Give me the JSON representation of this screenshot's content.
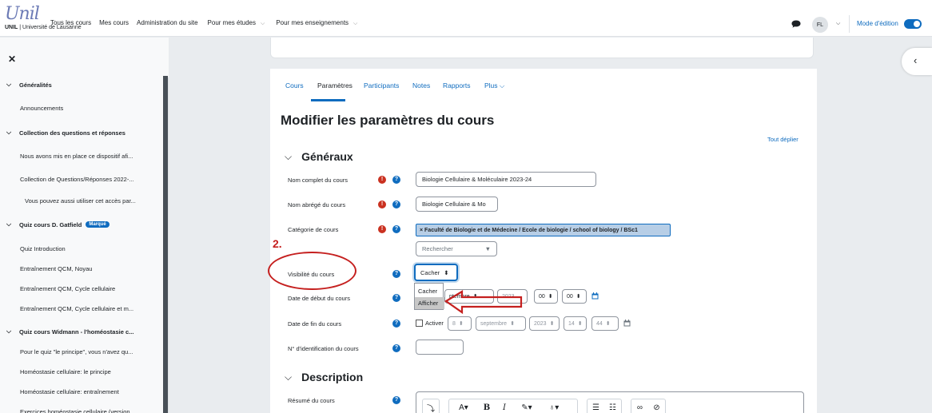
{
  "branding": {
    "logo_script": "Unil",
    "logo_sub_bold": "UNIL",
    "logo_sub_rest": " | Université de Lausanne"
  },
  "primary_nav": {
    "items": [
      "Tous les cours",
      "Mes cours",
      "Administration du site",
      "Pour mes études",
      "Pour mes enseignements"
    ]
  },
  "user": {
    "initials": "FL",
    "edit_mode_label": "Mode d'édition"
  },
  "course_index": {
    "rows": [
      {
        "type": "section",
        "label": "Généralités"
      },
      {
        "type": "item",
        "label": "Announcements"
      },
      {
        "type": "section",
        "label": "Collection des questions et réponses"
      },
      {
        "type": "item",
        "label": "Nous avons mis en place ce dispositif afi..."
      },
      {
        "type": "item",
        "label": "Collection de Questions/Réponses 2022-..."
      },
      {
        "type": "item-indent",
        "label": "Vous pouvez aussi utiliser cet accès par..."
      },
      {
        "type": "section",
        "label": "Quiz cours D. Gatfield",
        "badge": "Marqué"
      },
      {
        "type": "item",
        "label": "Quiz Introduction"
      },
      {
        "type": "item",
        "label": "Entraînement QCM, Noyau"
      },
      {
        "type": "item",
        "label": "Entraînement QCM, Cycle cellulaire"
      },
      {
        "type": "item",
        "label": "Entraînement QCM, Cycle cellulaire et m..."
      },
      {
        "type": "section",
        "label": "Quiz cours Widmann - l'homéostasie c..."
      },
      {
        "type": "item",
        "label": "Pour le quiz \"le principe\", vous n'avez qu..."
      },
      {
        "type": "item",
        "label": "Homéostasie cellulaire: le principe"
      },
      {
        "type": "item",
        "label": "Homéostasie cellulaire: entraînement"
      },
      {
        "type": "item",
        "label": "Exercices homéostasie cellulaire (version..."
      }
    ]
  },
  "secondary_nav": {
    "tabs": [
      "Cours",
      "Paramètres",
      "Participants",
      "Notes",
      "Rapports",
      "Plus"
    ],
    "active": "Paramètres"
  },
  "page": {
    "heading": "Modifier les paramètres du cours",
    "expand_all": "Tout déplier"
  },
  "sections": {
    "general": "Généraux",
    "description": "Description"
  },
  "form": {
    "fullname_label": "Nom complet du cours",
    "fullname_value": "Biologie Cellulaire & Moléculaire 2023-24",
    "shortname_label": "Nom abrégé du cours",
    "shortname_value": "Biologie Cellulaire & Mo",
    "category_label": "Catégorie de cours",
    "category_value": "× Faculté de Biologie et de Médecine / Ecole de biologie / school of biology / BSc1",
    "category_search": "Rechercher",
    "visibility_label": "Visibilité du cours",
    "visibility_value": "Cacher",
    "visibility_options": [
      "Cacher",
      "Afficher"
    ],
    "start_label": "Date de début du cours",
    "start_month_partial": "ptembre",
    "start_year": "2023",
    "start_hour": "00",
    "start_minute": "00",
    "end_label": "Date de fin du cours",
    "end_enable": "Activer",
    "end_day": "8",
    "end_month": "septembre",
    "end_year": "2023",
    "end_hour": "14",
    "end_minute": "44",
    "idnumber_label": "N° d'identification du cours",
    "summary_label": "Résumé du cours"
  },
  "annotation": {
    "step_number": "2."
  },
  "colors": {
    "primary": "#0f6cbf",
    "required": "#ca3120",
    "annotation": "#c5201f"
  }
}
